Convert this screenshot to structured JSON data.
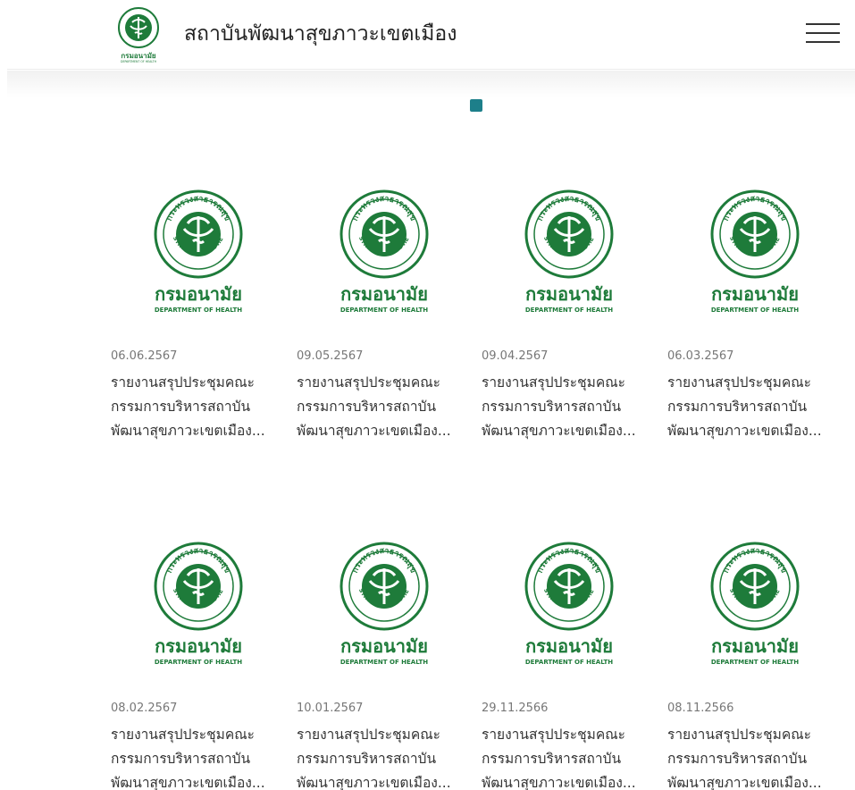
{
  "header": {
    "site_title": "สถาบันพัฒนาสุขภาวะเขตเมือง",
    "logo_text": "กรมอนามัย",
    "logo_subtext": "DEPARTMENT OF HEALTH",
    "menu_icon": "hamburger-icon"
  },
  "slider": {
    "dot_color": "#1d7f8a"
  },
  "theme": {
    "logo_green": "#1e7b3a"
  },
  "thumb": {
    "ring_text": "กระทรวงสาธารณสุข",
    "ministry_text": "MINISTRY OF PUBLIC HEALTH",
    "dept_name": "กรมอนามัย",
    "dept_en": "DEPARTMENT OF HEALTH"
  },
  "cards": [
    {
      "date": "06.06.2567",
      "lines": [
        "รายงานสรุปประชุมคณะ",
        "กรรมการบริหารสถาบัน",
        "พัฒนาสุขภาวะเขตเมือง..."
      ]
    },
    {
      "date": "09.05.2567",
      "lines": [
        "รายงานสรุปประชุมคณะ",
        "กรรมการบริหารสถาบัน",
        "พัฒนาสุขภาวะเขตเมือง..."
      ]
    },
    {
      "date": "09.04.2567",
      "lines": [
        "รายงานสรุปประชุมคณะ",
        "กรรมการบริหารสถาบัน",
        "พัฒนาสุขภาวะเขตเมือง..."
      ]
    },
    {
      "date": "06.03.2567",
      "lines": [
        "รายงานสรุปประชุมคณะ",
        "กรรมการบริหารสถาบัน",
        "พัฒนาสุขภาวะเขตเมือง..."
      ]
    },
    {
      "date": "08.02.2567",
      "lines": [
        "รายงานสรุปประชุมคณะ",
        "กรรมการบริหารสถาบัน",
        "พัฒนาสุขภาวะเขตเมือง..."
      ]
    },
    {
      "date": "10.01.2567",
      "lines": [
        "รายงานสรุปประชุมคณะ",
        "กรรมการบริหารสถาบัน",
        "พัฒนาสุขภาวะเขตเมือง..."
      ]
    },
    {
      "date": "29.11.2566",
      "lines": [
        "รายงานสรุปประชุมคณะ",
        "กรรมการบริหารสถาบัน",
        "พัฒนาสุขภาวะเขตเมือง..."
      ]
    },
    {
      "date": "08.11.2566",
      "lines": [
        "รายงานสรุปประชุมคณะ",
        "กรรมการบริหารสถาบัน",
        "พัฒนาสุขภาวะเขตเมือง..."
      ]
    }
  ]
}
